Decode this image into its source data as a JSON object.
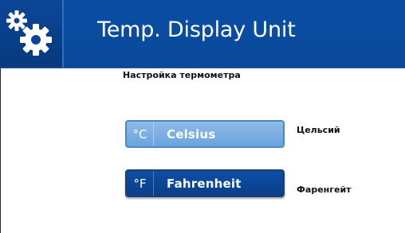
{
  "header": {
    "title": "Temp. Display Unit",
    "icon": "gears-icon"
  },
  "subtitle": "Настройка термометра",
  "units": [
    {
      "symbol": "°C",
      "label": "Celsius",
      "translation": "Цельсий",
      "state": "light"
    },
    {
      "symbol": "°F",
      "label": "Fahrenheit",
      "translation": "Фаренгейт",
      "state": "selected"
    }
  ],
  "colors": {
    "header_blue": "#0a4da3",
    "celsius_button": "#7fb1e4",
    "fahrenheit_button": "#0b4797"
  }
}
